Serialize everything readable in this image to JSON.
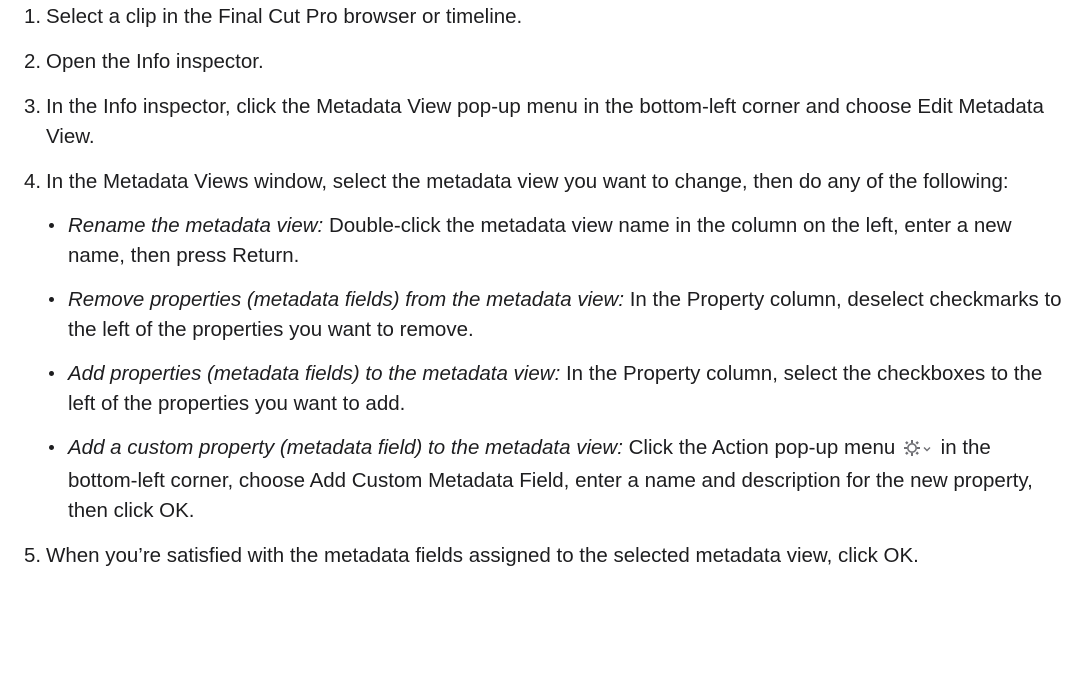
{
  "steps": [
    {
      "number": "1.",
      "text": "Select a clip in the Final Cut Pro browser or timeline."
    },
    {
      "number": "2.",
      "text": "Open the Info inspector."
    },
    {
      "number": "3.",
      "text": "In the Info inspector, click the Metadata View pop-up menu in the bottom-left corner and choose Edit Metadata View."
    },
    {
      "number": "4.",
      "text": "In the Metadata Views window, select the metadata view you want to change, then do any of the following:",
      "bullets": [
        {
          "term": "Rename the metadata view:",
          "text": " Double-click the metadata view name in the column on the left, enter a new name, then press Return."
        },
        {
          "term": "Remove properties (metadata fields) from the metadata view:",
          "text": " In the Property column, deselect checkmarks to the left of the properties you want to remove."
        },
        {
          "term": "Add properties (metadata fields) to the metadata view:",
          "text": " In the Property column, select the checkboxes to the left of the properties you want to add."
        },
        {
          "term": "Add a custom property (metadata field) to the metadata view:",
          "text_before_icon": " Click the Action pop-up menu",
          "icon": "action-gear-icon",
          "text_after_icon": " in the bottom-left corner, choose Add Custom Metadata Field, enter a name and description for the new property, then click OK."
        }
      ]
    },
    {
      "number": "5.",
      "text": "When you’re satisfied with the metadata fields assigned to the selected metadata view, click OK."
    }
  ]
}
